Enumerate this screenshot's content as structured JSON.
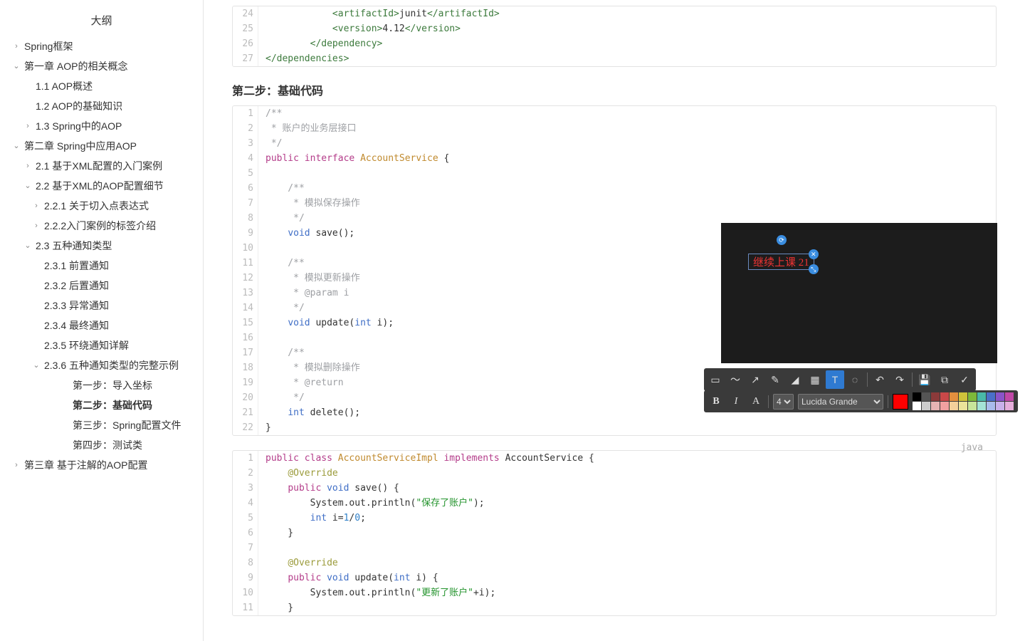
{
  "sidebar": {
    "title": "大纲",
    "items": [
      {
        "lvl": 1,
        "arrow": "›",
        "label": "Spring框架"
      },
      {
        "lvl": 1,
        "arrow": "⌄",
        "label": "第一章 AOP的相关概念"
      },
      {
        "lvl": 2,
        "arrow": "",
        "label": "1.1 AOP概述"
      },
      {
        "lvl": 2,
        "arrow": "",
        "label": "1.2 AOP的基础知识"
      },
      {
        "lvl": 2,
        "arrow": "›",
        "label": "1.3 Spring中的AOP"
      },
      {
        "lvl": 1,
        "arrow": "⌄",
        "label": "第二章 Spring中应用AOP"
      },
      {
        "lvl": 2,
        "arrow": "›",
        "label": "2.1 基于XML配置的入门案例"
      },
      {
        "lvl": 2,
        "arrow": "⌄",
        "label": "2.2 基于XML的AOP配置细节"
      },
      {
        "lvl": 3,
        "arrow": "›",
        "label": "2.2.1 关于切入点表达式"
      },
      {
        "lvl": 3,
        "arrow": "›",
        "label": "2.2.2入门案例的标签介绍"
      },
      {
        "lvl": 2,
        "arrow": "⌄",
        "label": "2.3 五种通知类型"
      },
      {
        "lvl": 3,
        "arrow": "",
        "label": "2.3.1 前置通知"
      },
      {
        "lvl": 3,
        "arrow": "",
        "label": "2.3.2 后置通知"
      },
      {
        "lvl": 3,
        "arrow": "",
        "label": "2.3.3 异常通知"
      },
      {
        "lvl": 3,
        "arrow": "",
        "label": "2.3.4 最终通知"
      },
      {
        "lvl": 3,
        "arrow": "",
        "label": "2.3.5 环绕通知详解"
      },
      {
        "lvl": 3,
        "arrow": "⌄",
        "label": "2.3.6 五种通知类型的完整示例"
      },
      {
        "lvl": 5,
        "arrow": "",
        "label": "第一步：导入坐标"
      },
      {
        "lvl": 5,
        "arrow": "",
        "label": "第二步：基础代码",
        "bold": true
      },
      {
        "lvl": 5,
        "arrow": "",
        "label": "第三步：Spring配置文件"
      },
      {
        "lvl": 5,
        "arrow": "",
        "label": "第四步：测试类"
      },
      {
        "lvl": 1,
        "arrow": "›",
        "label": "第三章 基于注解的AOP配置"
      }
    ]
  },
  "section": {
    "heading": "第二步：基础代码"
  },
  "code1": {
    "start": 24,
    "lines": [
      [
        {
          "t": "            ",
          "c": ""
        },
        {
          "t": "<artifactId>",
          "c": "c-tag"
        },
        {
          "t": "junit",
          "c": ""
        },
        {
          "t": "</artifactId>",
          "c": "c-tag"
        }
      ],
      [
        {
          "t": "            ",
          "c": ""
        },
        {
          "t": "<version>",
          "c": "c-tag"
        },
        {
          "t": "4.12",
          "c": ""
        },
        {
          "t": "</version>",
          "c": "c-tag"
        }
      ],
      [
        {
          "t": "        ",
          "c": ""
        },
        {
          "t": "</dependency>",
          "c": "c-tag"
        }
      ],
      [
        {
          "t": "</dependencies>",
          "c": "c-tag"
        }
      ]
    ]
  },
  "code2": {
    "start": 1,
    "lines": [
      [
        {
          "t": "/**",
          "c": "c-comment"
        }
      ],
      [
        {
          "t": " * 账户的业务层接口",
          "c": "c-comment"
        }
      ],
      [
        {
          "t": " */",
          "c": "c-comment"
        }
      ],
      [
        {
          "t": "public",
          "c": "c-kw"
        },
        {
          "t": " ",
          "c": ""
        },
        {
          "t": "interface",
          "c": "c-kw"
        },
        {
          "t": " ",
          "c": ""
        },
        {
          "t": "AccountService",
          "c": "c-class"
        },
        {
          "t": " {",
          "c": ""
        }
      ],
      [
        {
          "t": "",
          "c": ""
        }
      ],
      [
        {
          "t": "    /**",
          "c": "c-comment"
        }
      ],
      [
        {
          "t": "     * 模拟保存操作",
          "c": "c-comment"
        }
      ],
      [
        {
          "t": "     */",
          "c": "c-comment"
        }
      ],
      [
        {
          "t": "    ",
          "c": ""
        },
        {
          "t": "void",
          "c": "c-type"
        },
        {
          "t": " save();",
          "c": ""
        }
      ],
      [
        {
          "t": "",
          "c": ""
        }
      ],
      [
        {
          "t": "    /**",
          "c": "c-comment"
        }
      ],
      [
        {
          "t": "     * 模拟更新操作",
          "c": "c-comment"
        }
      ],
      [
        {
          "t": "     * @param i",
          "c": "c-comment"
        }
      ],
      [
        {
          "t": "     */",
          "c": "c-comment"
        }
      ],
      [
        {
          "t": "    ",
          "c": ""
        },
        {
          "t": "void",
          "c": "c-type"
        },
        {
          "t": " update(",
          "c": ""
        },
        {
          "t": "int",
          "c": "c-type"
        },
        {
          "t": " i);",
          "c": ""
        }
      ],
      [
        {
          "t": "",
          "c": ""
        }
      ],
      [
        {
          "t": "    /**",
          "c": "c-comment"
        }
      ],
      [
        {
          "t": "     * 模拟删除操作",
          "c": "c-comment"
        }
      ],
      [
        {
          "t": "     * @return",
          "c": "c-comment"
        }
      ],
      [
        {
          "t": "     */",
          "c": "c-comment"
        }
      ],
      [
        {
          "t": "    ",
          "c": ""
        },
        {
          "t": "int",
          "c": "c-type"
        },
        {
          "t": " delete();",
          "c": ""
        }
      ],
      [
        {
          "t": "}",
          "c": ""
        }
      ]
    ]
  },
  "code3": {
    "start": 1,
    "lang": "java",
    "lines": [
      [
        {
          "t": "public",
          "c": "c-kw"
        },
        {
          "t": " ",
          "c": ""
        },
        {
          "t": "class",
          "c": "c-kw"
        },
        {
          "t": " ",
          "c": ""
        },
        {
          "t": "AccountServiceImpl",
          "c": "c-class"
        },
        {
          "t": " ",
          "c": ""
        },
        {
          "t": "implements",
          "c": "c-kw"
        },
        {
          "t": " AccountService {",
          "c": ""
        }
      ],
      [
        {
          "t": "    ",
          "c": ""
        },
        {
          "t": "@Override",
          "c": "c-at"
        }
      ],
      [
        {
          "t": "    ",
          "c": ""
        },
        {
          "t": "public",
          "c": "c-kw"
        },
        {
          "t": " ",
          "c": ""
        },
        {
          "t": "void",
          "c": "c-type"
        },
        {
          "t": " save() {",
          "c": ""
        }
      ],
      [
        {
          "t": "        System.out.println(",
          "c": ""
        },
        {
          "t": "\"保存了账户\"",
          "c": "c-str"
        },
        {
          "t": ");",
          "c": ""
        }
      ],
      [
        {
          "t": "        ",
          "c": ""
        },
        {
          "t": "int",
          "c": "c-type"
        },
        {
          "t": " i=",
          "c": ""
        },
        {
          "t": "1",
          "c": "c-num"
        },
        {
          "t": "/",
          "c": ""
        },
        {
          "t": "0",
          "c": "c-num"
        },
        {
          "t": ";",
          "c": ""
        }
      ],
      [
        {
          "t": "    }",
          "c": ""
        }
      ],
      [
        {
          "t": "",
          "c": ""
        }
      ],
      [
        {
          "t": "    ",
          "c": ""
        },
        {
          "t": "@Override",
          "c": "c-at"
        }
      ],
      [
        {
          "t": "    ",
          "c": ""
        },
        {
          "t": "public",
          "c": "c-kw"
        },
        {
          "t": " ",
          "c": ""
        },
        {
          "t": "void",
          "c": "c-type"
        },
        {
          "t": " update(",
          "c": ""
        },
        {
          "t": "int",
          "c": "c-type"
        },
        {
          "t": " i) {",
          "c": ""
        }
      ],
      [
        {
          "t": "        System.out.println(",
          "c": ""
        },
        {
          "t": "\"更新了账户\"",
          "c": "c-str"
        },
        {
          "t": "+i);",
          "c": ""
        }
      ],
      [
        {
          "t": "    }",
          "c": ""
        }
      ]
    ]
  },
  "overlay": {
    "text": "继续上课 21"
  },
  "toolbar2": {
    "size": "4",
    "font": "Lucida Grande",
    "palette_top": [
      "#000000",
      "#555555",
      "#8b3a3a",
      "#c94848",
      "#e38f3e",
      "#cfc23a",
      "#7db93a",
      "#49b9a8",
      "#4a6fc9",
      "#8a54c9",
      "#c048a7"
    ],
    "palette_bot": [
      "#ffffff",
      "#cccccc",
      "#e6b3b3",
      "#f0a0a0",
      "#f3cf9a",
      "#ece39a",
      "#c7e59a",
      "#a4e3d6",
      "#a9bbec",
      "#c9b0ea",
      "#e6aedb"
    ]
  }
}
